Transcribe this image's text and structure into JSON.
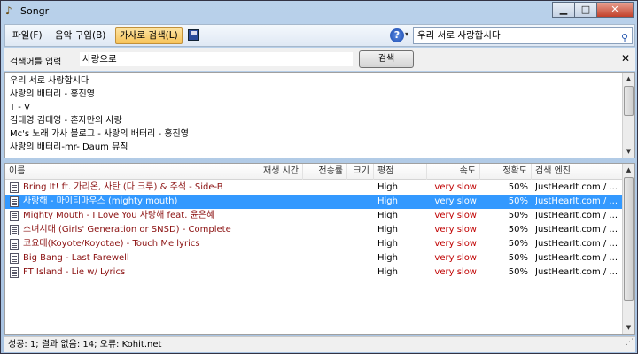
{
  "window": {
    "title": "Songr",
    "app_icon": "music-note-icon",
    "min_glyph": "▁",
    "max_glyph": "□",
    "close_glyph": "✕"
  },
  "menubar": {
    "file": "파일(F)",
    "buy": "음악 구입(B)",
    "lyrics": "가사로 검색(L)",
    "save_icon": "save-icon",
    "help_glyph": "?",
    "help_caret": "▾",
    "search_value": "우리 서로 사랑합시다",
    "search_icon_glyph": "⚲"
  },
  "searchbar": {
    "label": "검색어를 입력",
    "value": "사랑으로",
    "button": "검색",
    "close_glyph": "✕"
  },
  "suggestions": [
    "우리 서로 사랑합시다",
    "사랑의 배터리 - 홍진영",
    "T - V",
    "김태영 김태영 - 혼자만의 사랑",
    "Mc's 노래 가사 블로그 - 사랑의 배터리 - 홍진영",
    "사랑의 배터리-mr- Daum 뮤직"
  ],
  "columns": {
    "name": "이름",
    "play_time": "재생 시간",
    "bitrate": "전송률",
    "size": "크기",
    "rating": "평점",
    "speed": "속도",
    "accuracy": "정확도",
    "engine": "검색 엔진"
  },
  "rows": [
    {
      "name": "Bring It! ft. 가리온, 사탄 (다 크루) & 주석 - Side-B",
      "rating": "High",
      "speed": "very slow",
      "accuracy": "50%",
      "engine": "JustHearIt.com / ..."
    },
    {
      "name": "사랑해 - 마이티마우스 (mighty mouth)",
      "rating": "High",
      "speed": "very slow",
      "accuracy": "50%",
      "engine": "JustHearIt.com / ..."
    },
    {
      "name": "Mighty Mouth - I Love You 사랑해 feat. 윤은혜",
      "rating": "High",
      "speed": "very slow",
      "accuracy": "50%",
      "engine": "JustHearIt.com / ..."
    },
    {
      "name": "소녀시대 (Girls' Generation or SNSD) - Complete",
      "rating": "High",
      "speed": "very slow",
      "accuracy": "50%",
      "engine": "JustHearIt.com / ..."
    },
    {
      "name": "코요태(Koyote/Koyotae) - Touch Me lyrics",
      "rating": "High",
      "speed": "very slow",
      "accuracy": "50%",
      "engine": "JustHearIt.com / ..."
    },
    {
      "name": "Big Bang - Last Farewell",
      "rating": "High",
      "speed": "very slow",
      "accuracy": "50%",
      "engine": "JustHearIt.com / ..."
    },
    {
      "name": "FT Island - Lie w/ Lyrics",
      "rating": "High",
      "speed": "very slow",
      "accuracy": "50%",
      "engine": "JustHearIt.com / ..."
    }
  ],
  "selected_row": 1,
  "status": "성공: 1; 결과 없음: 14; 오류: Kohit.net"
}
